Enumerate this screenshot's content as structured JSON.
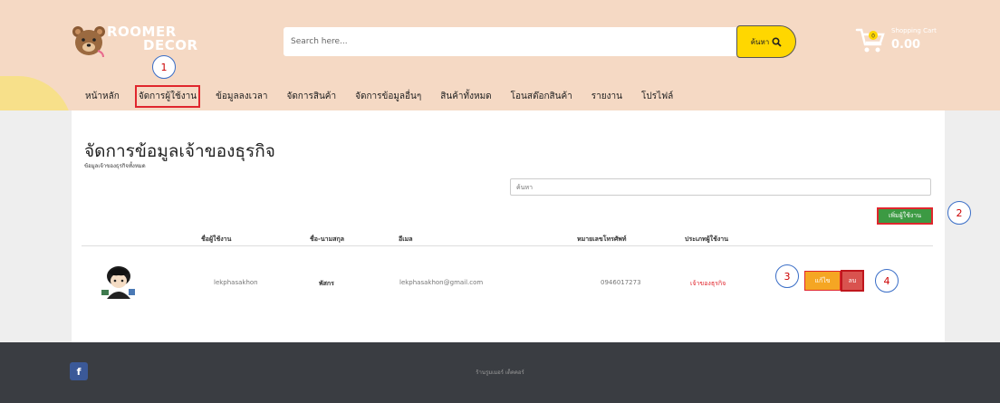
{
  "header": {
    "logo_line1": "ROOMER",
    "logo_line2": "DECOR",
    "search_placeholder": "Search here...",
    "search_button": "ค้นหา",
    "cart_title": "Shopping Cart",
    "cart_amount": "0.00",
    "cart_count": "0"
  },
  "nav": {
    "items": [
      {
        "label": "หน้าหลัก"
      },
      {
        "label": "จัดการผู้ใช้งาน",
        "active": true
      },
      {
        "label": "ข้อมูลลงเวลา"
      },
      {
        "label": "จัดการสินค้า"
      },
      {
        "label": "จัดการข้อมูลอื่นๆ"
      },
      {
        "label": "สินค้าทั้งหมด"
      },
      {
        "label": "โอนสต๊อกสินค้า"
      },
      {
        "label": "รายงาน"
      },
      {
        "label": "โปรไฟล์"
      }
    ]
  },
  "page": {
    "title": "จัดการข้อมูลเจ้าของธุรกิจ",
    "subtitle": "ข้อมูลเจ้าของธุรกิจทั้งหมด",
    "table_search_placeholder": "ค้นหา",
    "add_button": "เพิ่มผู้ใช้งาน"
  },
  "table": {
    "headers": [
      "ชื่อผู้ใช้งาน",
      "ชื่อ-นามสกุล",
      "อีเมล",
      "หมายเลขโทรศัพท์",
      "ประเภทผู้ใช้งาน"
    ],
    "rows": [
      {
        "username": "lekphasakhon",
        "fullname": "พัสกร",
        "email": "lekphasakhon@gmail.com",
        "phone": "0946017273",
        "user_type": "เจ้าของธุรกิจ",
        "edit_label": "แก้ไข",
        "delete_label": "ลบ"
      }
    ]
  },
  "callouts": [
    "1",
    "2",
    "3",
    "4"
  ],
  "footer": {
    "text": "ร้านรูมเมอร์ เด็คคอร์",
    "social_icon": "f"
  },
  "colors": {
    "header_bg": "#f5d9c4",
    "accent_yellow": "#ffd700",
    "highlight_red": "#e0262d",
    "add_green": "#3c9a43",
    "edit_orange": "#f5a623",
    "delete_red": "#d9534f",
    "footer_bg": "#3a3d42"
  }
}
